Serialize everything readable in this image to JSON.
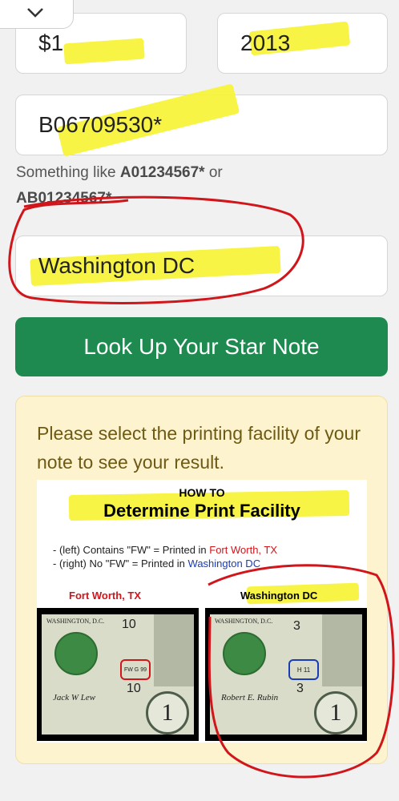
{
  "collapse_icon": "chevron-down-icon",
  "fields": {
    "denomination": "$1",
    "year": "2013",
    "serial": "B06709530*",
    "facility": "Washington DC"
  },
  "hint": {
    "prefix": "Something like",
    "example1": "A01234567*",
    "or": "or",
    "example2": "AB01234567*"
  },
  "lookup_button": "Look Up Your Star Note",
  "panel": {
    "message": "Please select the printing facility of your note to see your result.",
    "infographic": {
      "title_small": "HOW TO",
      "title_large": "Determine Print Facility",
      "line1_prefix": "- (left) Contains \"FW\" = Printed in ",
      "line1_place": "Fort Worth, TX",
      "line2_prefix": "- (right) No \"FW\" = Printed in ",
      "line2_place": "Washington DC",
      "left_label": "Fort Worth, TX",
      "right_label": "Washington DC",
      "left_bill": {
        "header": "WASHINGTON, D.C.",
        "num_top": "10",
        "num_bottom": "10",
        "code": "FW G 99",
        "signature": "Jack W Lew"
      },
      "right_bill": {
        "header": "WASHINGTON, D.C.",
        "num_top": "3",
        "num_bottom": "3",
        "code": "H 11",
        "signature": "Robert E. Rubin"
      }
    }
  },
  "colors": {
    "button": "#1e8a4f",
    "highlight": "#f7f33b",
    "annotation": "#d0161b"
  }
}
